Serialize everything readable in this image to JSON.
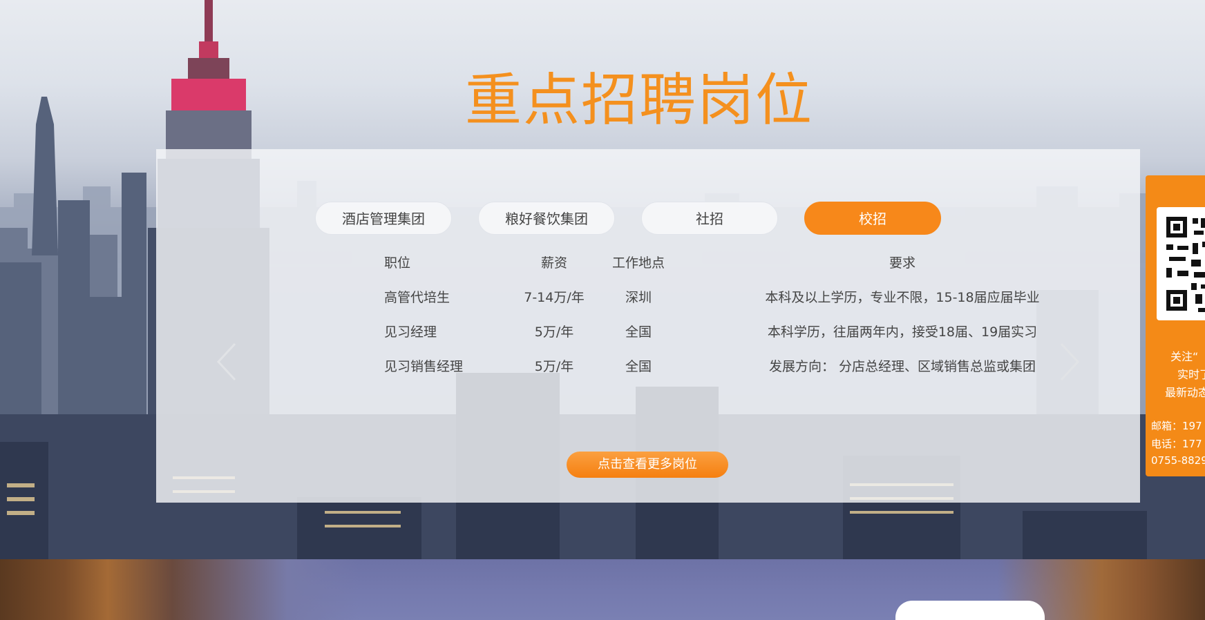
{
  "page": {
    "heading": "重点招聘岗位"
  },
  "tabs": [
    {
      "label": "酒店管理集团",
      "active": false
    },
    {
      "label": "粮好餐饮集团",
      "active": false
    },
    {
      "label": "社招",
      "active": false
    },
    {
      "label": "校招",
      "active": true
    }
  ],
  "jobs_table": {
    "headers": {
      "position": "职位",
      "salary": "薪资",
      "location": "工作地点",
      "requirement": "要求"
    },
    "rows": [
      {
        "position": "高管代培生",
        "salary": "7-14万/年",
        "location": "深圳",
        "requirement": "本科及以上学历，专业不限，15-18届应届毕业"
      },
      {
        "position": "见习经理",
        "salary": "5万/年",
        "location": "全国",
        "requirement": "本科学历，往届两年内，接受18届、19届实习"
      },
      {
        "position": "见习销售经理",
        "salary": "5万/年",
        "location": "全国",
        "requirement": "发展方向：  分店总经理、区域销售总监或集团"
      }
    ]
  },
  "more_button": {
    "label": "点击查看更多岗位"
  },
  "side_widget": {
    "follow": "关注“",
    "realtime": "实时了",
    "news": "最新动态",
    "email": "邮箱：197",
    "phone": "电话：177",
    "phone2": "0755-8829"
  },
  "colors": {
    "accent": "#f7881a",
    "heading": "#f4901e",
    "panel": "#f4f5f8"
  }
}
